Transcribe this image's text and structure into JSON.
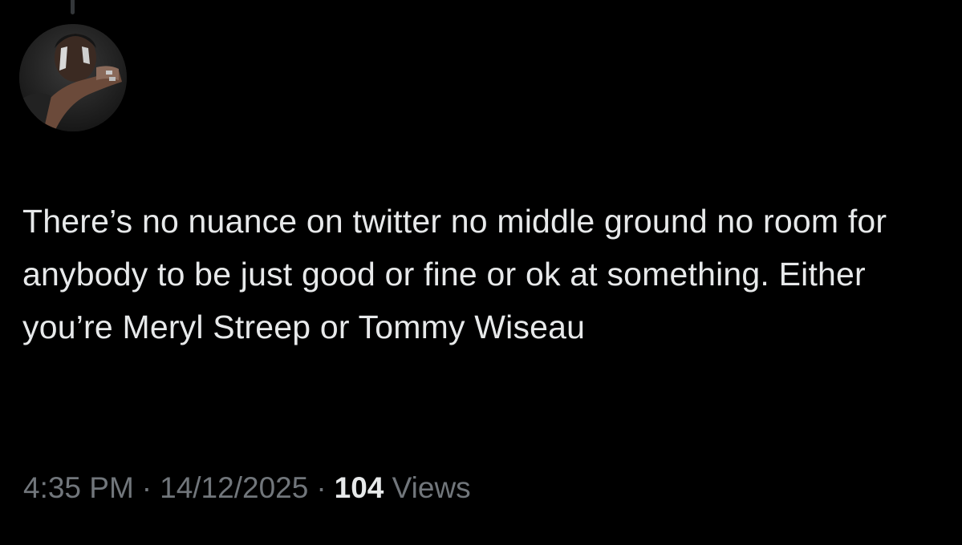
{
  "tweet": {
    "text": "There’s no nuance on twitter no middle ground no room for anybody to be just good or fine or ok at something. Either you’re Meryl Streep or Tommy Wiseau",
    "time": "4:35 PM",
    "separator": "·",
    "date": "14/12/2025",
    "views_count": "104",
    "views_label": "Views"
  },
  "avatar": {
    "icon": "profile-photo"
  },
  "colors": {
    "background": "#000000",
    "text": "#e7e9ea",
    "secondary_text": "#71767b",
    "thread_line": "#333639"
  }
}
